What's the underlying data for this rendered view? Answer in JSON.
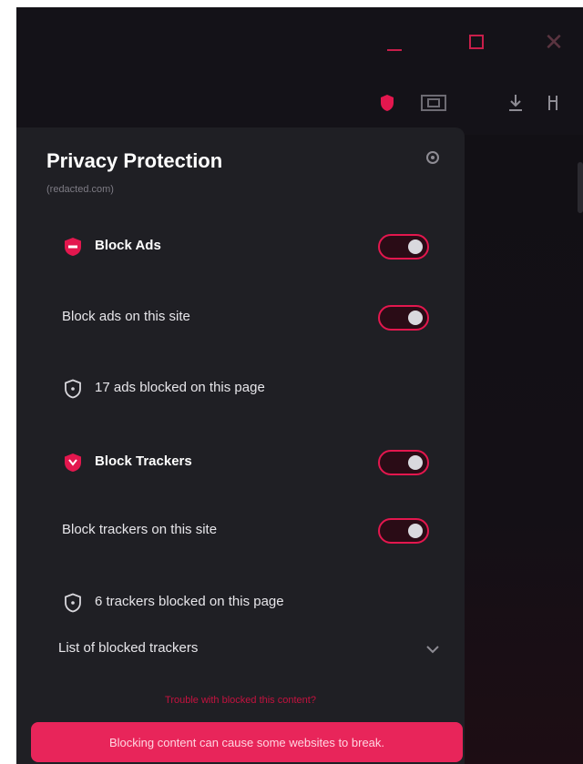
{
  "window_controls": {
    "minimize_icon": "minimize-icon",
    "maximize_icon": "maximize-icon",
    "close_symbol": "✕"
  },
  "toolbar": {
    "icons": [
      "privacy-shield-icon",
      "screenshot-icon",
      "download-icon",
      "extensions-icon"
    ]
  },
  "panel": {
    "title": "Privacy Protection",
    "subtitle": "(redacted.com)",
    "settings_icon": "gear-icon",
    "block_ads": {
      "label": "Block Ads",
      "icon": "ad-block-shield-icon",
      "enabled": true,
      "site_label": "Block ads on this site",
      "site_enabled": true,
      "count_text": "17 ads blocked on this page"
    },
    "block_trackers": {
      "label": "Block Trackers",
      "icon": "tracker-shield-icon",
      "enabled": true,
      "site_label": "Block trackers on this site",
      "site_enabled": true,
      "count_text": "6 trackers blocked on this page",
      "list_label": "List of blocked trackers"
    },
    "report_link": "Trouble with blocked this content?",
    "banner_text": "Blocking content can cause some websites to break."
  },
  "colors": {
    "accent": "#e3174e",
    "panel_bg": "#1f1f24",
    "window_bg": "#141218",
    "banner_bg": "#e8255a"
  }
}
